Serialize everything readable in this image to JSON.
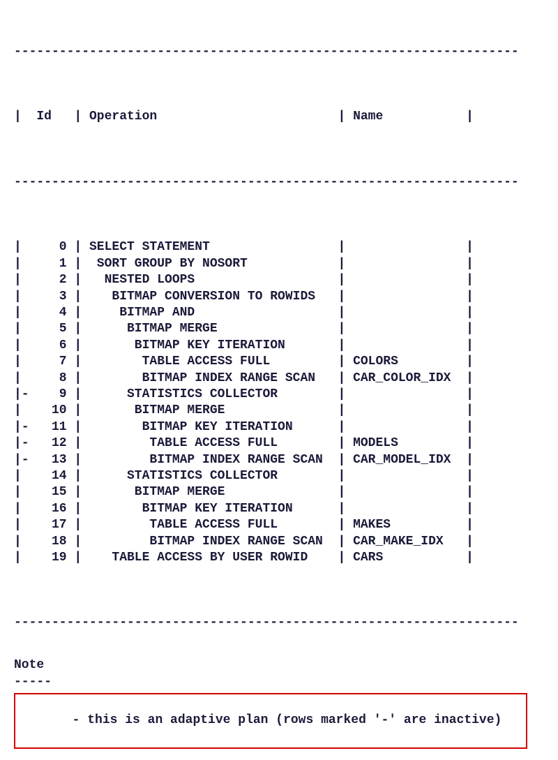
{
  "columns": {
    "id": "Id",
    "operation": "Operation",
    "name": "Name"
  },
  "dash": "-------------------------------------------------------------------",
  "rows": [
    {
      "mark": "| ",
      "id": "0",
      "indent": 0,
      "op": "SELECT STATEMENT",
      "name": ""
    },
    {
      "mark": "| ",
      "id": "1",
      "indent": 1,
      "op": "SORT GROUP BY NOSORT",
      "name": ""
    },
    {
      "mark": "| ",
      "id": "2",
      "indent": 2,
      "op": "NESTED LOOPS",
      "name": ""
    },
    {
      "mark": "| ",
      "id": "3",
      "indent": 3,
      "op": "BITMAP CONVERSION TO ROWIDS",
      "name": ""
    },
    {
      "mark": "| ",
      "id": "4",
      "indent": 4,
      "op": "BITMAP AND",
      "name": ""
    },
    {
      "mark": "| ",
      "id": "5",
      "indent": 5,
      "op": "BITMAP MERGE",
      "name": ""
    },
    {
      "mark": "| ",
      "id": "6",
      "indent": 6,
      "op": "BITMAP KEY ITERATION",
      "name": ""
    },
    {
      "mark": "| ",
      "id": "7",
      "indent": 7,
      "op": "TABLE ACCESS FULL",
      "name": "COLORS"
    },
    {
      "mark": "| ",
      "id": "8",
      "indent": 7,
      "op": "BITMAP INDEX RANGE SCAN",
      "name": "CAR_COLOR_IDX"
    },
    {
      "mark": "|-",
      "id": "9",
      "indent": 5,
      "op": "STATISTICS COLLECTOR",
      "name": ""
    },
    {
      "mark": "| ",
      "id": "10",
      "indent": 6,
      "op": "BITMAP MERGE",
      "name": ""
    },
    {
      "mark": "|-",
      "id": "11",
      "indent": 7,
      "op": "BITMAP KEY ITERATION",
      "name": ""
    },
    {
      "mark": "|-",
      "id": "12",
      "indent": 8,
      "op": "TABLE ACCESS FULL",
      "name": "MODELS"
    },
    {
      "mark": "|-",
      "id": "13",
      "indent": 8,
      "op": "BITMAP INDEX RANGE SCAN",
      "name": "CAR_MODEL_IDX"
    },
    {
      "mark": "| ",
      "id": "14",
      "indent": 5,
      "op": "STATISTICS COLLECTOR",
      "name": ""
    },
    {
      "mark": "| ",
      "id": "15",
      "indent": 6,
      "op": "BITMAP MERGE",
      "name": ""
    },
    {
      "mark": "| ",
      "id": "16",
      "indent": 7,
      "op": "BITMAP KEY ITERATION",
      "name": ""
    },
    {
      "mark": "| ",
      "id": "17",
      "indent": 8,
      "op": "TABLE ACCESS FULL",
      "name": "MAKES"
    },
    {
      "mark": "| ",
      "id": "18",
      "indent": 8,
      "op": "BITMAP INDEX RANGE SCAN",
      "name": "CAR_MAKE_IDX"
    },
    {
      "mark": "| ",
      "id": "19",
      "indent": 3,
      "op": "TABLE ACCESS BY USER ROWID",
      "name": "CARS"
    }
  ],
  "note_title": "Note",
  "note_rule": "-----",
  "note_text": "   - this is an adaptive plan (rows marked '-' are inactive)"
}
